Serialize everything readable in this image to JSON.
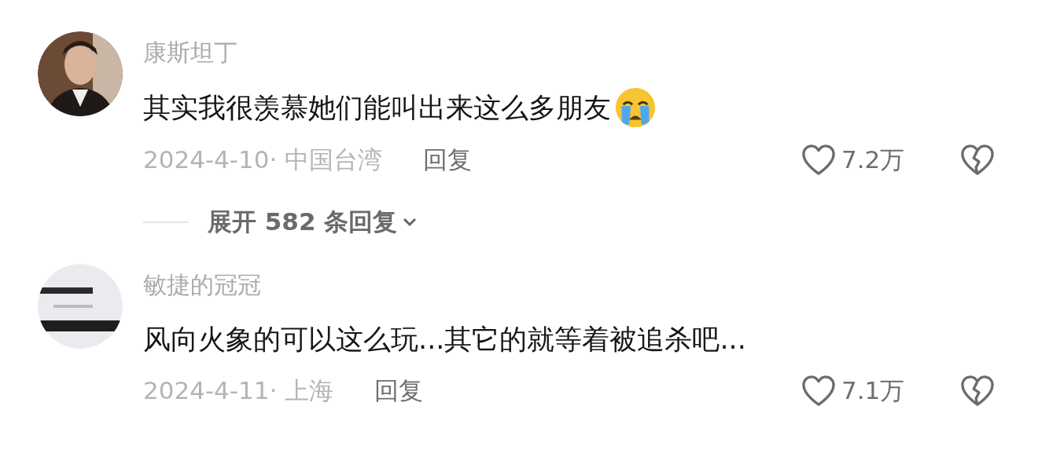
{
  "comments": [
    {
      "username": "康斯坦丁",
      "avatar": {
        "kind": "person"
      },
      "text": "其实我很羡慕她们能叫出来这么多朋友",
      "emoji_after": true,
      "date": "2024-4-10·",
      "location": "中国台湾",
      "reply_label": "回复",
      "likes": "7.2万",
      "expand": {
        "prefix": "展开",
        "count": "582",
        "suffix": "条回复"
      }
    },
    {
      "username": "敏捷的冠冠",
      "text": "风向火象的可以这么玩...其它的就等着被追杀吧...",
      "emoji_after": false,
      "date": "2024-4-11·",
      "location": "上海",
      "reply_label": "回复",
      "likes": "7.1万"
    }
  ]
}
